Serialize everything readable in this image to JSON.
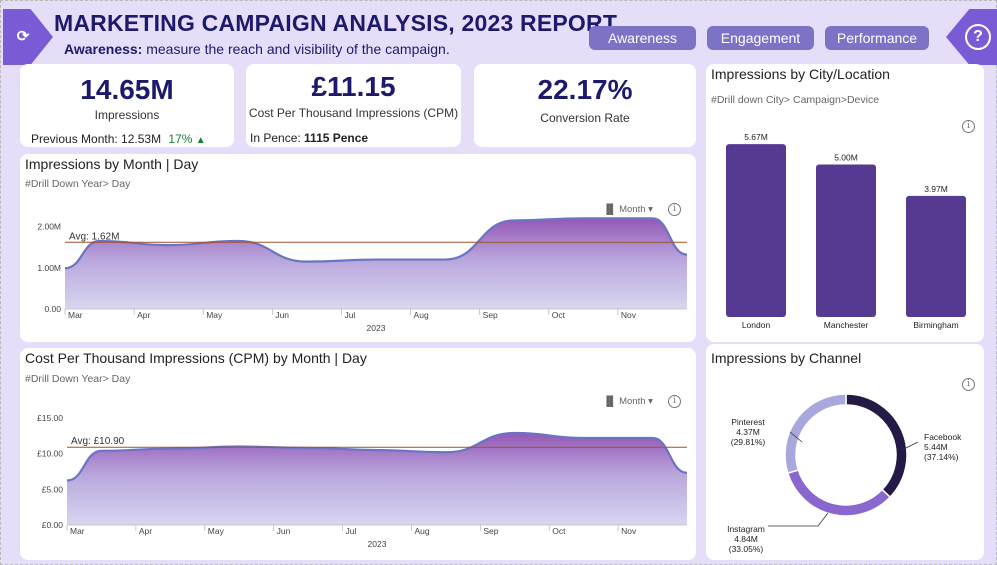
{
  "header": {
    "title": "MARKETING CAMPAIGN ANALYSIS, 2023 REPORT",
    "subtitle_bold": "Awareness:",
    "subtitle_text": " measure the  reach  and visibility of the campaign.",
    "left_icon": "reset-icon",
    "right_icon": "help-icon",
    "nav": [
      "Awareness",
      "Engagement",
      "Performance"
    ]
  },
  "kpis": {
    "impressions": {
      "value": "14.65M",
      "label": "Impressions",
      "prev_label": "Previous Month: 12.53M",
      "change": "17%",
      "arrow": "▲"
    },
    "cpm": {
      "value": "£11.15",
      "label": "Cost Per Thousand Impressions (CPM)",
      "pence_label": "In Pence:",
      "pence_value": "1115 Pence"
    },
    "conversion": {
      "value": "22.17%",
      "label": "Conversion Rate"
    }
  },
  "month_control": "Month",
  "colors": {
    "accent": "#7a5bd6",
    "navy": "#1d1a6b",
    "bar": "#563a92",
    "avg_line": "#a0522d",
    "line": "#6a74c4",
    "up": "#1a7f37"
  },
  "chart_data": [
    {
      "type": "area",
      "title": "Impressions by Month | Day",
      "subtitle": "#Drill Down Year> Day",
      "x": [
        "Mar",
        "Apr",
        "May",
        "Jun",
        "Jul",
        "Aug",
        "Sep",
        "Oct",
        "Nov"
      ],
      "xlabel": "2023",
      "yticks": [
        "0.00",
        "1.00M",
        "2.00M"
      ],
      "ylim": [
        0,
        2.5
      ],
      "values": [
        1.65,
        1.55,
        1.65,
        1.15,
        1.2,
        1.2,
        2.15,
        2.2,
        2.2
      ],
      "avg_label": "Avg: 1.62M",
      "avg": 1.62
    },
    {
      "type": "area",
      "title": "Cost Per Thousand Impressions (CPM) by Month | Day",
      "subtitle": "#Drill Down Year> Day",
      "x": [
        "Mar",
        "Apr",
        "May",
        "Jun",
        "Jul",
        "Aug",
        "Sep",
        "Oct",
        "Nov"
      ],
      "xlabel": "2023",
      "yticks": [
        "£0.00",
        "£5.00",
        "£10.00",
        "£15.00"
      ],
      "ylim": [
        0,
        15
      ],
      "values": [
        10.4,
        10.7,
        11.0,
        10.8,
        10.5,
        10.2,
        12.9,
        12.2,
        12.2
      ],
      "avg_label": "Avg: £10.90",
      "avg": 10.9
    },
    {
      "type": "bar",
      "title": "Impressions by City/Location",
      "subtitle": "#Drill down City> Campaign>Device",
      "categories": [
        "London",
        "Manchester",
        "Birmingham"
      ],
      "values": [
        5.67,
        5.0,
        3.97
      ],
      "labels": [
        "5.67M",
        "5.00M",
        "3.97M"
      ],
      "ylim": [
        0,
        6
      ]
    },
    {
      "type": "pie",
      "title": "Impressions by Channel",
      "slices": [
        {
          "name": "Facebook",
          "value": 5.44,
          "value_label": "5.44M",
          "pct_label": "(37.14%)",
          "color": "#241a45"
        },
        {
          "name": "Instagram",
          "value": 4.84,
          "value_label": "4.84M",
          "pct_label": "(33.05%)",
          "color": "#8a66cf"
        },
        {
          "name": "Pinterest",
          "value": 4.37,
          "value_label": "4.37M",
          "pct_label": "(29.81%)",
          "color": "#a9a8de"
        }
      ]
    }
  ]
}
